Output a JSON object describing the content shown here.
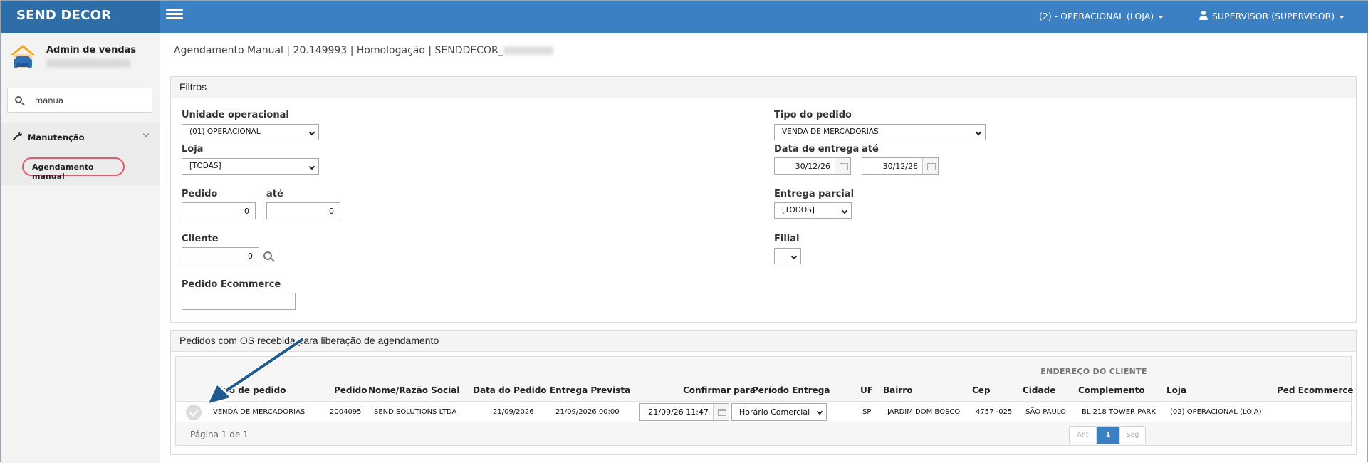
{
  "app": {
    "brand": "SEND DECOR"
  },
  "topnav": {
    "store_menu": "(2) - OPERACIONAL (LOJA)",
    "user_menu": "SUPERVISOR (SUPERVISOR)"
  },
  "sidebar": {
    "profile_title": "Admin de vendas",
    "search_value": "manua",
    "group_label": "Manutenção",
    "item_label": "Agendamento manual"
  },
  "page": {
    "title": "Agendamento Manual | 20.149993 | Homologação | SENDDECOR_"
  },
  "filters": {
    "panel_title": "Filtros",
    "unidade_label": "Unidade operacional",
    "unidade_value": "(01) OPERACIONAL",
    "loja_label": "Loja",
    "loja_value": "[TODAS]",
    "pedido_label": "Pedido",
    "pedido_from": "0",
    "ate_label": "até",
    "pedido_to": "0",
    "cliente_label": "Cliente",
    "cliente_value": "0",
    "ecommerce_label": "Pedido Ecommerce",
    "ecommerce_value": "",
    "tipo_label": "Tipo do pedido",
    "tipo_value": "VENDA DE MERCADORIAS",
    "data_label": "Data de entrega",
    "data_from": "30/12/26",
    "data_ate_label": "até",
    "data_to": "30/12/26",
    "parcial_label": "Entrega parcial",
    "parcial_value": "[TODOS]",
    "filial_label": "Filial",
    "filial_value": ""
  },
  "results": {
    "panel_title": "Pedidos com OS recebida para liberação de agendamento",
    "group_header": "ENDEREÇO DO CLIENTE",
    "columns": {
      "tipo": "Tipo de pedido",
      "pedido": "Pedido",
      "nome": "Nome/Razão Social",
      "data_pedido": "Data do Pedido",
      "entrega": "Entrega Prevista",
      "confirmar": "Confirmar para",
      "periodo": "Período Entrega",
      "uf": "UF",
      "bairro": "Bairro",
      "cep": "Cep",
      "cidade": "Cidade",
      "complemento": "Complemento",
      "loja": "Loja",
      "ecommerce": "Ped Ecommerce"
    },
    "rows": [
      {
        "tipo": "VENDA DE MERCADORIAS",
        "pedido": "2004095",
        "nome": "SEND SOLUTIONS LTDA",
        "data_pedido": "21/09/2026",
        "entrega": "21/09/2026 00:00",
        "confirmar": "21/09/26 11:47",
        "periodo": "Horário Comercial",
        "uf": "SP",
        "bairro": "JARDIM DOM BOSCO",
        "cep": "4757 -025",
        "cidade": "SÃO PAULO",
        "complemento": "BL 218 TOWER PARK",
        "loja": "(02) OPERACIONAL (LOJA)",
        "ecommerce": ""
      }
    ],
    "page_info": "Página 1 de 1",
    "pager": {
      "prev": "Ant",
      "current": "1",
      "next": "Seg"
    }
  },
  "colors": {
    "topbar": "#3a80c2",
    "brand_bg": "#2d6ea9",
    "highlight": "#e05a6d",
    "arrow": "#1f5a8e"
  }
}
